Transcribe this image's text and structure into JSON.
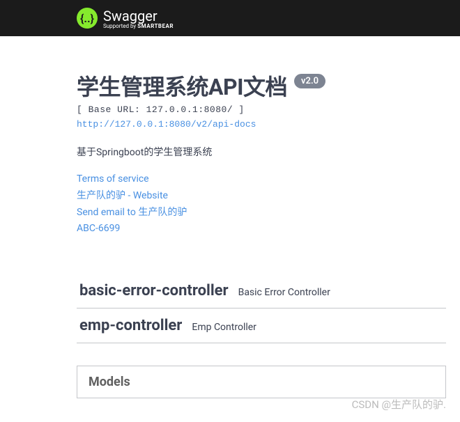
{
  "topbar": {
    "brand": "Swagger",
    "supported_prefix": "Supported by ",
    "supported_brand": "SMARTBEAR",
    "logo_glyph": "{..}"
  },
  "info": {
    "title": "学生管理系统API文档",
    "version": "v2.0",
    "base_url_label": "[ Base URL: 127.0.0.1:8080/ ]",
    "api_docs_url": "http://127.0.0.1:8080/v2/api-docs",
    "description": "基于Springboot的学生管理系统",
    "terms_of_service": "Terms of service",
    "contact_website": "生产队的驴 - Website",
    "contact_email": "Send email to 生产队的驴",
    "license": "ABC-6699"
  },
  "tags": [
    {
      "name": "basic-error-controller",
      "description": "Basic Error Controller"
    },
    {
      "name": "emp-controller",
      "description": "Emp Controller"
    }
  ],
  "models": {
    "heading": "Models"
  },
  "watermark": "CSDN @生产队的驴."
}
